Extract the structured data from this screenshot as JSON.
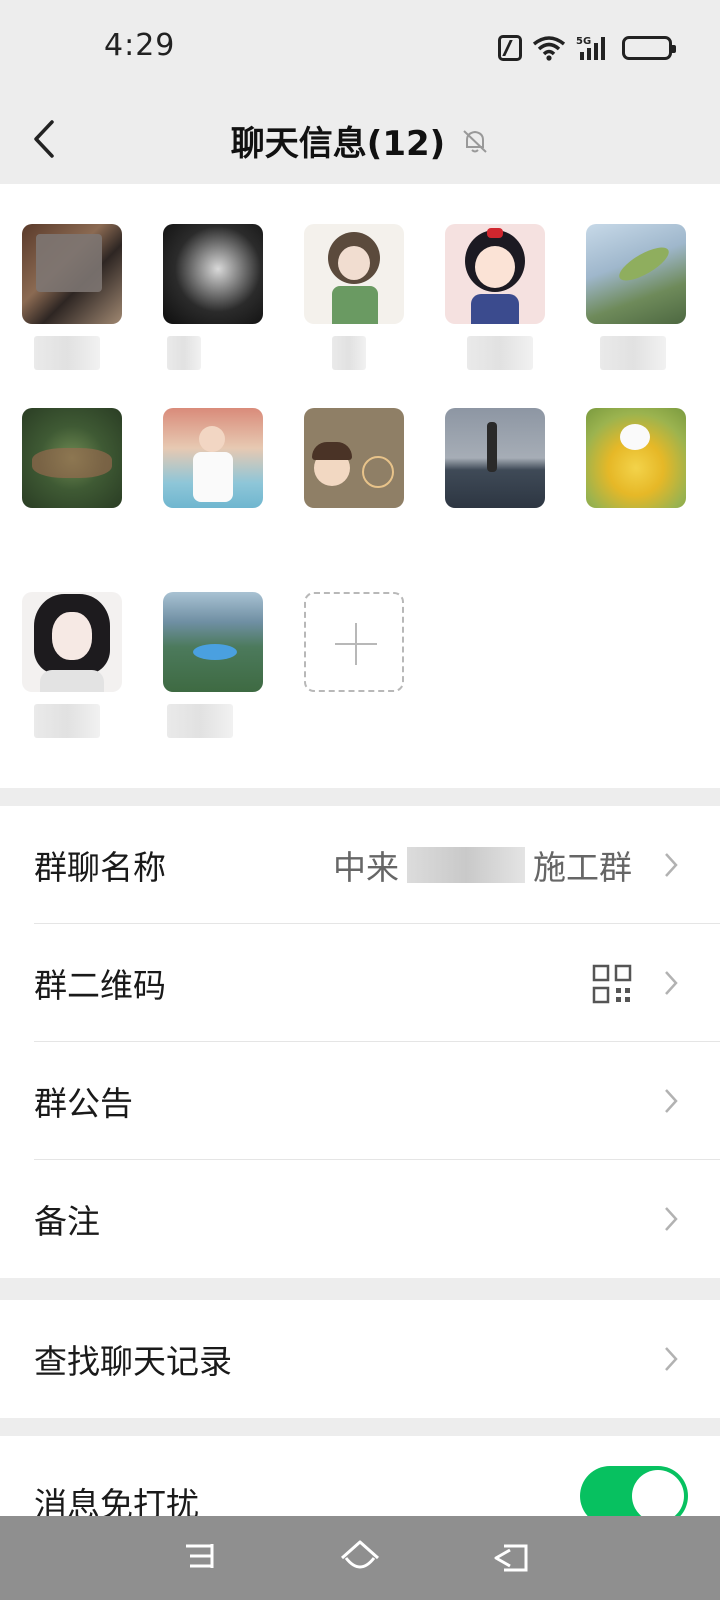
{
  "status_bar": {
    "time": "4:29",
    "network": "5G"
  },
  "header": {
    "title": "聊天信息(12)"
  },
  "members": [
    {
      "name": "",
      "avatar": "member-photo-1"
    },
    {
      "name": "",
      "avatar": "member-photo-2"
    },
    {
      "name": "",
      "avatar": "member-photo-3"
    },
    {
      "name": "",
      "avatar": "member-photo-4"
    },
    {
      "name": "",
      "avatar": "member-photo-5"
    },
    {
      "name": "",
      "avatar": "member-photo-6"
    },
    {
      "name": "",
      "avatar": "member-photo-7"
    },
    {
      "name": "",
      "avatar": "member-photo-8"
    },
    {
      "name": "",
      "avatar": "member-photo-9"
    },
    {
      "name": "",
      "avatar": "member-photo-10"
    },
    {
      "name": "",
      "avatar": "member-photo-11"
    },
    {
      "name": "",
      "avatar": "member-photo-12"
    }
  ],
  "settings": {
    "group_name_label": "群聊名称",
    "group_name_prefix": "中来",
    "group_name_suffix": "施工群",
    "qr_label": "群二维码",
    "notice_label": "群公告",
    "remark_label": "备注",
    "search_label": "查找聊天记录",
    "mute_label": "消息免打扰",
    "mute_enabled": true
  },
  "colors": {
    "accent": "#07c160",
    "background": "#ededed"
  }
}
